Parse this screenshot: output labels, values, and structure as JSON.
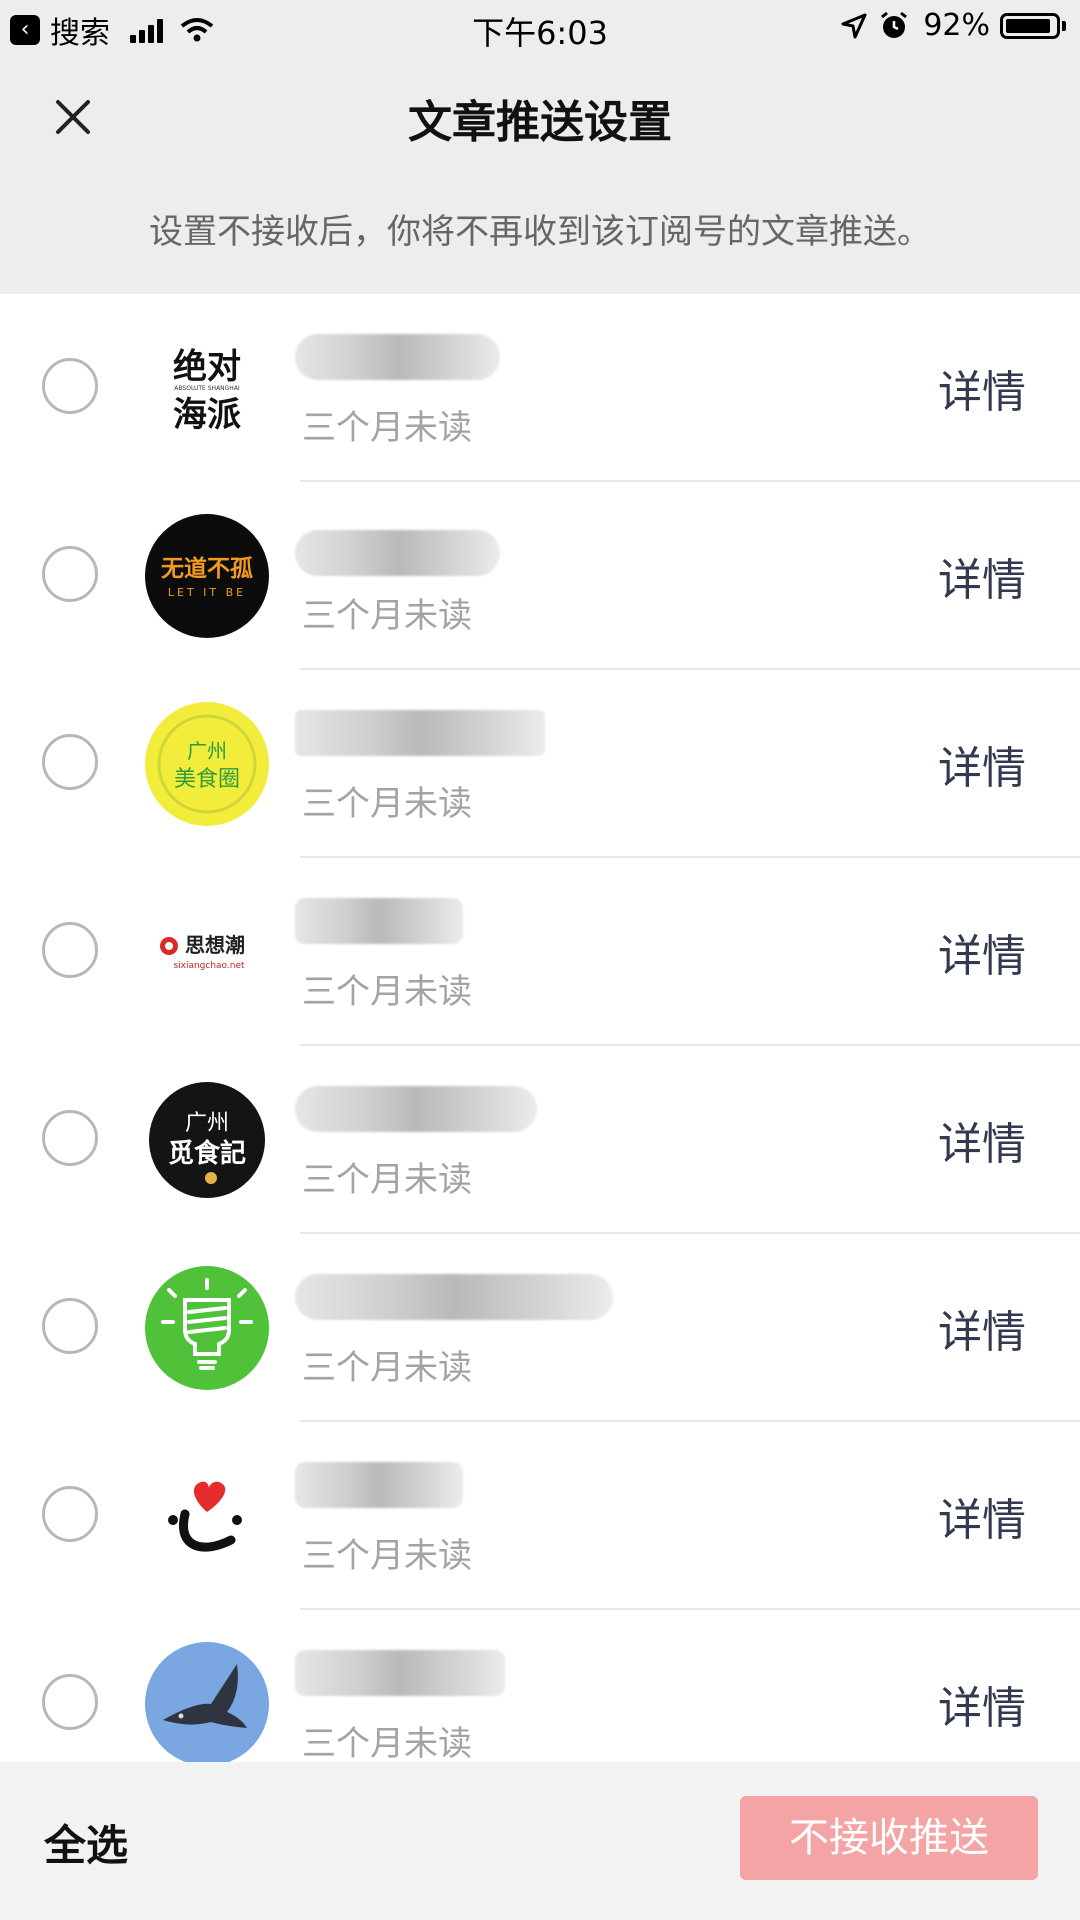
{
  "status_bar": {
    "back_label": "搜索",
    "time": "下午6:03",
    "battery_text": "92%",
    "battery_level": 0.92
  },
  "header": {
    "title": "文章推送设置",
    "notice": "设置不接收后，你将不再收到该订阅号的文章推送。"
  },
  "accounts": [
    {
      "logo_text": "绝对\n海派",
      "logo_sub": "ABSOLUTE SHANGHAI",
      "status": "三个月未读",
      "detail": "详情"
    },
    {
      "logo_text": "无道不孤",
      "logo_sub": "LET IT BE",
      "status": "三个月未读",
      "detail": "详情"
    },
    {
      "logo_text": "广州\n美食圈",
      "status": "三个月未读",
      "detail": "详情"
    },
    {
      "logo_text": "思想潮",
      "logo_sub": "sixiangchao.net",
      "status": "三个月未读",
      "detail": "详情"
    },
    {
      "logo_text": "广州\n觅食記",
      "status": "三个月未读",
      "detail": "详情"
    },
    {
      "status": "三个月未读",
      "detail": "详情"
    },
    {
      "logo_text": "心",
      "status": "三个月未读",
      "detail": "详情"
    },
    {
      "status": "三个月未读",
      "detail": "详情"
    }
  ],
  "footer": {
    "select_all": "全选",
    "reject_button": "不接收推送"
  },
  "colors": {
    "header_bg": "#ededed",
    "reject_button_bg": "#f4a4a4",
    "detail_text": "#333a50"
  }
}
